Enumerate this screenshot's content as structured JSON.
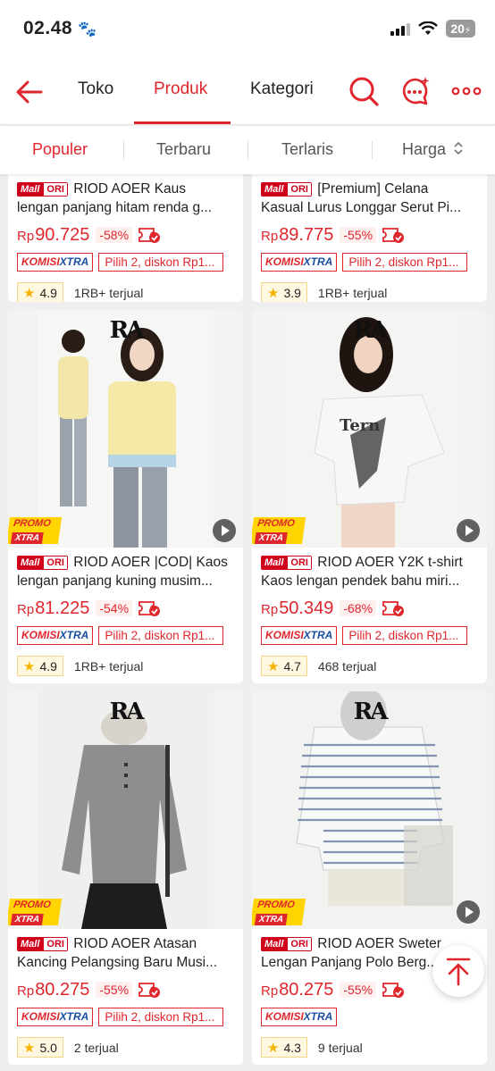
{
  "status_bar": {
    "time": "02.48",
    "battery": "20"
  },
  "header": {
    "tabs": [
      {
        "label": "Toko"
      },
      {
        "label": "Produk"
      },
      {
        "label": "Kategori"
      }
    ]
  },
  "sort": {
    "options": [
      {
        "label": "Populer"
      },
      {
        "label": "Terbaru"
      },
      {
        "label": "Terlaris"
      },
      {
        "label": "Harga"
      }
    ]
  },
  "badges": {
    "mall": "Mall",
    "ori": "ORI",
    "promo_top": "PROMO",
    "promo_bottom": "XTRA",
    "komisi_a": "KOMISI",
    "komisi_b": "XTRA",
    "brand": "RA",
    "currency": "Rp"
  },
  "products": [
    {
      "title_1": "RIOD AOER Kaus",
      "title_2": "lengan panjang hitam renda g...",
      "price": "90.725",
      "discount": "-58%",
      "voucher": "Pilih 2, diskon Rp1...",
      "rating": "4.9",
      "sold": "1RB+ terjual"
    },
    {
      "title_1": "[Premium] Celana",
      "title_2": "Kasual Lurus Longgar Serut Pi...",
      "price": "89.775",
      "discount": "-55%",
      "voucher": "Pilih 2, diskon Rp1...",
      "rating": "3.9",
      "sold": "1RB+ terjual"
    },
    {
      "title_1": "RIOD AOER |COD| Kaos",
      "title_2": "lengan panjang kuning musim...",
      "price": "81.225",
      "discount": "-54%",
      "voucher": "Pilih 2, diskon Rp1...",
      "rating": "4.9",
      "sold": "1RB+ terjual"
    },
    {
      "title_1": "RIOD AOER  Y2K t-shirt",
      "title_2": "Kaos lengan pendek bahu miri...",
      "price": "50.349",
      "discount": "-68%",
      "voucher": "Pilih 2, diskon Rp1...",
      "rating": "4.7",
      "sold": "468 terjual"
    },
    {
      "title_1": "RIOD AOER Atasan",
      "title_2": "Kancing Pelangsing Baru Musi...",
      "price": "80.275",
      "discount": "-55%",
      "voucher": "Pilih 2, diskon Rp1...",
      "rating": "5.0",
      "sold": "2 terjual"
    },
    {
      "title_1": "RIOD AOER Sweter",
      "title_2": "Lengan Panjang Polo Berg...",
      "price": "80.275",
      "discount": "-55%",
      "voucher": "",
      "rating": "4.3",
      "sold": "9 terjual"
    }
  ],
  "colors": {
    "accent": "#e0262d",
    "mall": "#d0011b",
    "komisi_blue": "#1a4fa0",
    "promo_yellow": "#ffd400"
  }
}
